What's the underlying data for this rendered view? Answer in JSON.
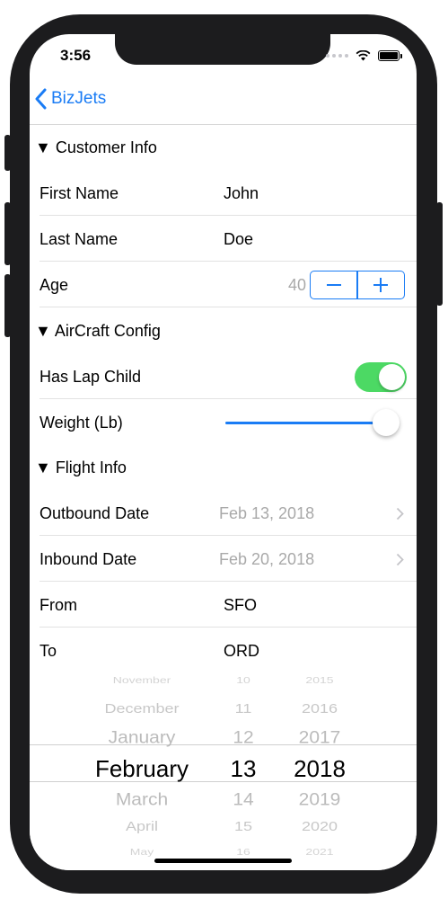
{
  "status": {
    "time": "3:56"
  },
  "nav": {
    "back_label": "BizJets"
  },
  "sections": {
    "customer": "▼ Customer Info",
    "aircraft": "▼ AirCraft Config",
    "flight": "▼ Flight Info"
  },
  "customer": {
    "first_name_label": "First Name",
    "first_name_value": "John",
    "last_name_label": "Last Name",
    "last_name_value": "Doe",
    "age_label": "Age",
    "age_value": "40"
  },
  "aircraft": {
    "lap_child_label": "Has Lap Child",
    "lap_child_on": true,
    "weight_label": "Weight (Lb)",
    "weight_fraction": 0.97
  },
  "flight": {
    "outbound_label": "Outbound Date",
    "outbound_value": "Feb 13, 2018",
    "inbound_label": "Inbound Date",
    "inbound_value": "Feb 20, 2018",
    "from_label": "From",
    "from_value": "SFO",
    "to_label": "To",
    "to_value": "ORD"
  },
  "picker": {
    "months": [
      "November",
      "December",
      "January",
      "February",
      "March",
      "April",
      "May"
    ],
    "days": [
      "10",
      "11",
      "12",
      "13",
      "14",
      "15",
      "16"
    ],
    "years": [
      "2015",
      "2016",
      "2017",
      "2018",
      "2019",
      "2020",
      "2021"
    ]
  },
  "colors": {
    "accent": "#1a7cf5",
    "toggle_on": "#4cd964"
  }
}
